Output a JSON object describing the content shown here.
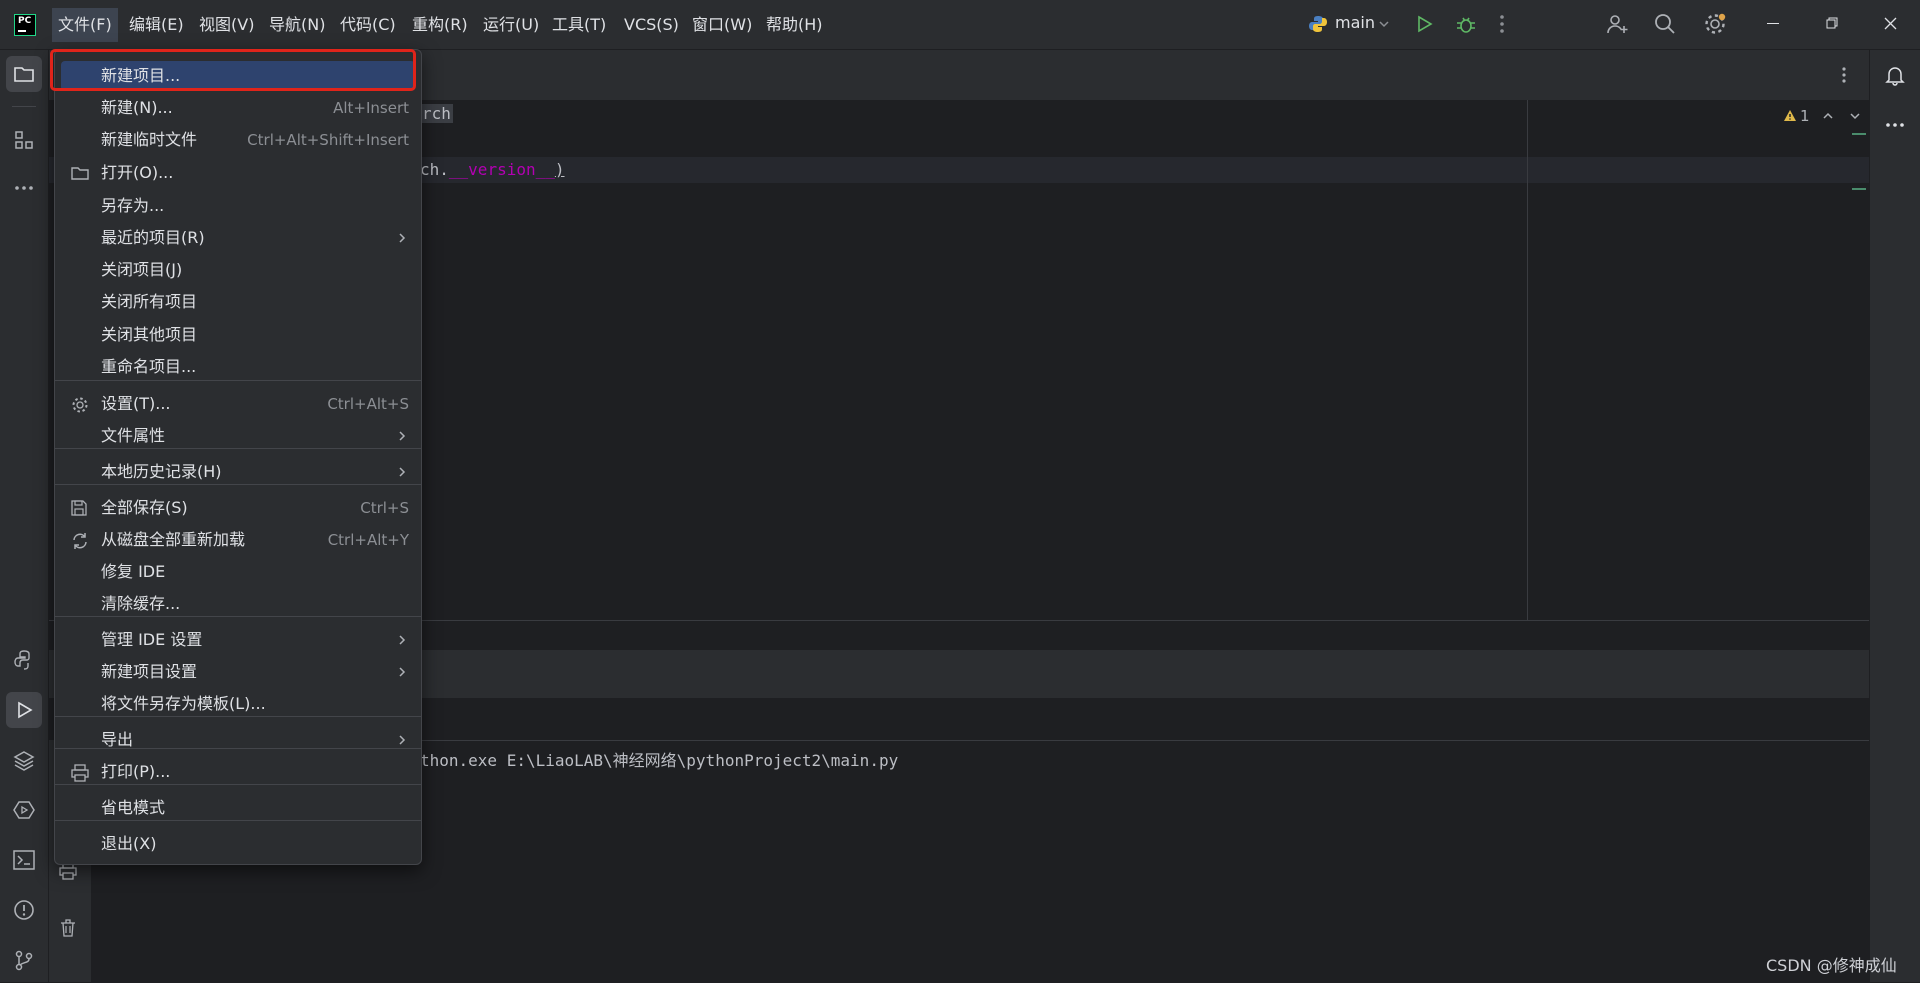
{
  "menubar": {
    "items": [
      "文件(F)",
      "编辑(E)",
      "视图(V)",
      "导航(N)",
      "代码(C)",
      "重构(R)",
      "运行(U)",
      "工具(T)",
      "VCS(S)",
      "窗口(W)",
      "帮助(H)"
    ],
    "run_config": "main"
  },
  "editor": {
    "line1_fragment": "rch",
    "line2_fragment_a": "ch.",
    "line2_fragment_b": "__version__",
    "line2_fragment_c": ")",
    "warning_count": "1"
  },
  "console": {
    "line": "thon.exe E:\\LiaoLAB\\神经网络\\pythonProject2\\main.py"
  },
  "file_menu": {
    "items": [
      {
        "label": "新建项目...",
        "shortcut": "",
        "icon": "",
        "submenu": false,
        "selected": true
      },
      {
        "label": "新建(N)...",
        "shortcut": "Alt+Insert",
        "icon": "",
        "submenu": false
      },
      {
        "label": "新建临时文件",
        "shortcut": "Ctrl+Alt+Shift+Insert",
        "icon": "",
        "submenu": false
      },
      {
        "label": "打开(O)...",
        "shortcut": "",
        "icon": "folder-icon",
        "submenu": false
      },
      {
        "label": "另存为...",
        "shortcut": "",
        "icon": "",
        "submenu": false
      },
      {
        "label": "最近的项目(R)",
        "shortcut": "",
        "icon": "",
        "submenu": true
      },
      {
        "label": "关闭项目(J)",
        "shortcut": "",
        "icon": "",
        "submenu": false
      },
      {
        "label": "关闭所有项目",
        "shortcut": "",
        "icon": "",
        "submenu": false
      },
      {
        "label": "关闭其他项目",
        "shortcut": "",
        "icon": "",
        "submenu": false
      },
      {
        "label": "重命名项目...",
        "shortcut": "",
        "icon": "",
        "submenu": false
      },
      {
        "label": "设置(T)...",
        "shortcut": "Ctrl+Alt+S",
        "icon": "gear-icon",
        "submenu": false
      },
      {
        "label": "文件属性",
        "shortcut": "",
        "icon": "",
        "submenu": true
      },
      {
        "label": "本地历史记录(H)",
        "shortcut": "",
        "icon": "",
        "submenu": true
      },
      {
        "label": "全部保存(S)",
        "shortcut": "Ctrl+S",
        "icon": "save-icon",
        "submenu": false
      },
      {
        "label": "从磁盘全部重新加载",
        "shortcut": "Ctrl+Alt+Y",
        "icon": "reload-icon",
        "submenu": false
      },
      {
        "label": "修复 IDE",
        "shortcut": "",
        "icon": "",
        "submenu": false
      },
      {
        "label": "清除缓存...",
        "shortcut": "",
        "icon": "",
        "submenu": false
      },
      {
        "label": "管理 IDE 设置",
        "shortcut": "",
        "icon": "",
        "submenu": true
      },
      {
        "label": "新建项目设置",
        "shortcut": "",
        "icon": "",
        "submenu": true
      },
      {
        "label": "将文件另存为模板(L)...",
        "shortcut": "",
        "icon": "",
        "submenu": false
      },
      {
        "label": "导出",
        "shortcut": "",
        "icon": "",
        "submenu": true
      },
      {
        "label": "打印(P)...",
        "shortcut": "",
        "icon": "print-icon",
        "submenu": false
      },
      {
        "label": "省电模式",
        "shortcut": "",
        "icon": "",
        "submenu": false
      },
      {
        "label": "退出(X)",
        "shortcut": "",
        "icon": "",
        "submenu": false
      }
    ]
  },
  "watermark": "CSDN @修神成仙",
  "colors": {
    "selection": "#2e436e",
    "highlight_border": "#e0241a",
    "menu_bg": "#2b2d30"
  }
}
